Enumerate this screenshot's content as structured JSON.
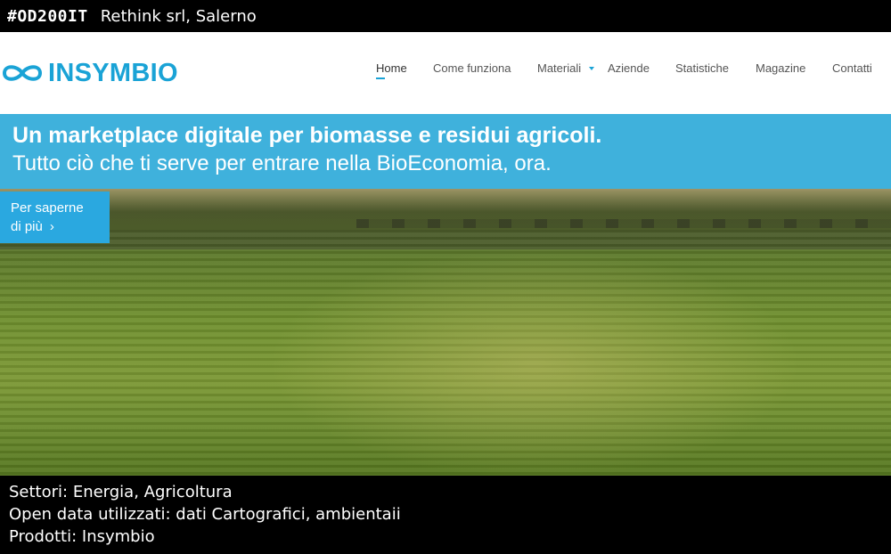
{
  "topbar": {
    "hashtag": "#OD200IT",
    "company": "Rethink srl, Salerno"
  },
  "site": {
    "logo_text": "INSYMBIO",
    "logo_icon": "infinity-icon",
    "nav": [
      {
        "label": "Home",
        "active": true
      },
      {
        "label": "Come funziona"
      },
      {
        "label": "Materiali",
        "has_dropdown": true
      },
      {
        "label": "Aziende"
      },
      {
        "label": "Statistiche"
      },
      {
        "label": "Magazine"
      },
      {
        "label": "Contatti"
      }
    ],
    "banner": {
      "title": "Un marketplace digitale per biomasse e residui agricoli.",
      "subtitle": "Tutto ciò che ti serve per entrare nella BioEconomia, ora."
    },
    "cta": {
      "line1": "Per saperne",
      "line2": "di più",
      "chevron": "›"
    },
    "colors": {
      "brand": "#1aa3d6",
      "banner": "#3fb1dc",
      "cta": "#2aa8e0"
    }
  },
  "footer": {
    "settori": "Settori: Energia, Agricoltura",
    "open_data": "Open data utilizzati: dati Cartografici, ambientaii",
    "prodotti": "Prodotti: Insymbio"
  }
}
